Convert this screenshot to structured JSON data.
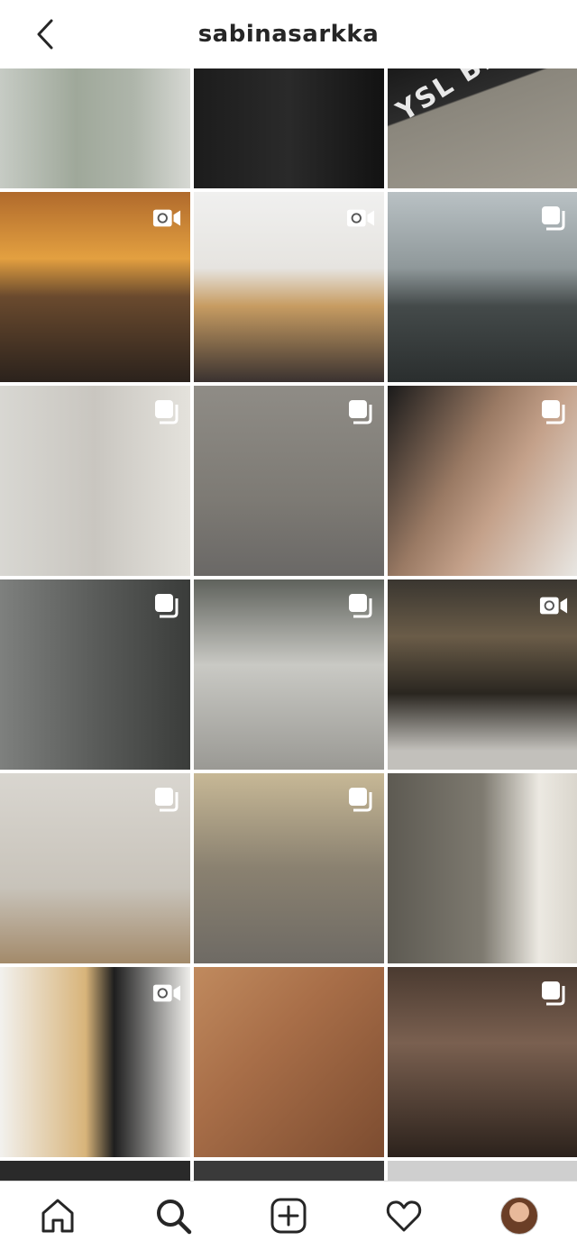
{
  "header": {
    "title": "sabinasarkka",
    "back_icon": "chevron-left-icon"
  },
  "posts": [
    {
      "type": "photo"
    },
    {
      "type": "photo"
    },
    {
      "type": "photo",
      "overlay_text": "YSL BE"
    },
    {
      "type": "video",
      "badge_icon": "igtv-icon"
    },
    {
      "type": "video",
      "badge_icon": "igtv-icon"
    },
    {
      "type": "carousel",
      "badge_icon": "carousel-icon"
    },
    {
      "type": "carousel",
      "badge_icon": "carousel-icon"
    },
    {
      "type": "carousel",
      "badge_icon": "carousel-icon"
    },
    {
      "type": "carousel",
      "badge_icon": "carousel-icon"
    },
    {
      "type": "carousel",
      "badge_icon": "carousel-icon"
    },
    {
      "type": "carousel",
      "badge_icon": "carousel-icon"
    },
    {
      "type": "video",
      "badge_icon": "igtv-icon"
    },
    {
      "type": "carousel",
      "badge_icon": "carousel-icon"
    },
    {
      "type": "carousel",
      "badge_icon": "carousel-icon"
    },
    {
      "type": "photo"
    },
    {
      "type": "video",
      "badge_icon": "igtv-icon"
    },
    {
      "type": "photo"
    },
    {
      "type": "carousel",
      "badge_icon": "carousel-icon"
    }
  ],
  "tabbar": {
    "items": [
      {
        "icon": "home-icon"
      },
      {
        "icon": "search-icon",
        "active": true
      },
      {
        "icon": "add-post-icon"
      },
      {
        "icon": "heart-icon"
      },
      {
        "icon": "profile-avatar"
      }
    ]
  },
  "colors": {
    "text": "#262626",
    "background": "#ffffff",
    "divider": "#dbdbdb"
  }
}
